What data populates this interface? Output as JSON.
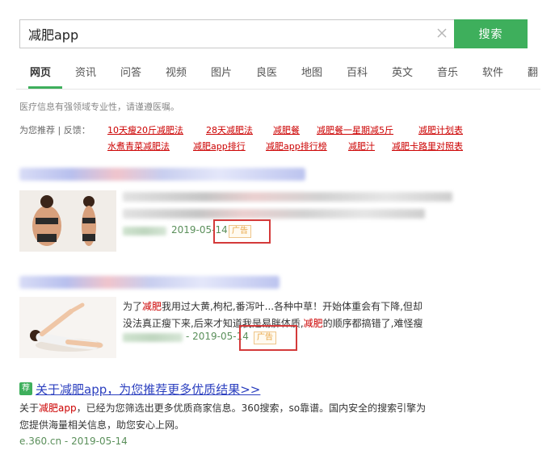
{
  "search": {
    "query": "减肥app",
    "button_label": "搜索"
  },
  "tabs": [
    {
      "label": "网页",
      "active": true
    },
    {
      "label": "资讯"
    },
    {
      "label": "问答"
    },
    {
      "label": "视频"
    },
    {
      "label": "图片"
    },
    {
      "label": "良医"
    },
    {
      "label": "地图"
    },
    {
      "label": "百科"
    },
    {
      "label": "英文"
    },
    {
      "label": "音乐"
    },
    {
      "label": "软件"
    },
    {
      "label": "翻"
    }
  ],
  "notice": "医疗信息有强领域专业性，请谨遵医嘱。",
  "recommend": {
    "label": "为您推荐 | 反馈：",
    "links": [
      "10天瘦20斤减肥法",
      "28天减肥法",
      "减肥餐",
      "减肥餐一星期减5斤",
      "减肥计划表",
      "水煮青菜减肥法",
      "减肥app排行",
      "减肥app排行榜",
      "减肥汁",
      "减肥卡路里对照表"
    ]
  },
  "result1": {
    "date": "2019-05-14",
    "ad_label": "广告"
  },
  "result2": {
    "snippet_line1": {
      "a": "为了",
      "hl1": "减肥",
      "b": "我用过大黄,枸杞,番泻叶...各种中草！开始体重会有下降,但却"
    },
    "snippet_line2": {
      "a": "没法真正瘦下来,后来才知道我是易胖体质,",
      "hl1": "减肥",
      "b": "的顺序都搞错了,难怪瘦"
    },
    "date": "- 2019-05-14",
    "ad_label": "广告"
  },
  "result3": {
    "badge": "荐",
    "title": "关于减肥app，为您推荐更多优质结果>>",
    "snippet_line1": {
      "a": "关于",
      "hl1": "减肥app",
      "b": "，已经为您筛选出更多优质商家信息。360搜索，so靠谱。国内安全的搜索引擎为"
    },
    "snippet_line2": "您提供海量相关信息，助您安心上网。",
    "url": "e.360.cn - 2019-05-14"
  },
  "colors": {
    "accent": "#3eaf5c",
    "link": "#2b3fbf",
    "highlight": "#cc0000",
    "ad": "#e8a646",
    "annotation_box": "#d43a3a"
  }
}
